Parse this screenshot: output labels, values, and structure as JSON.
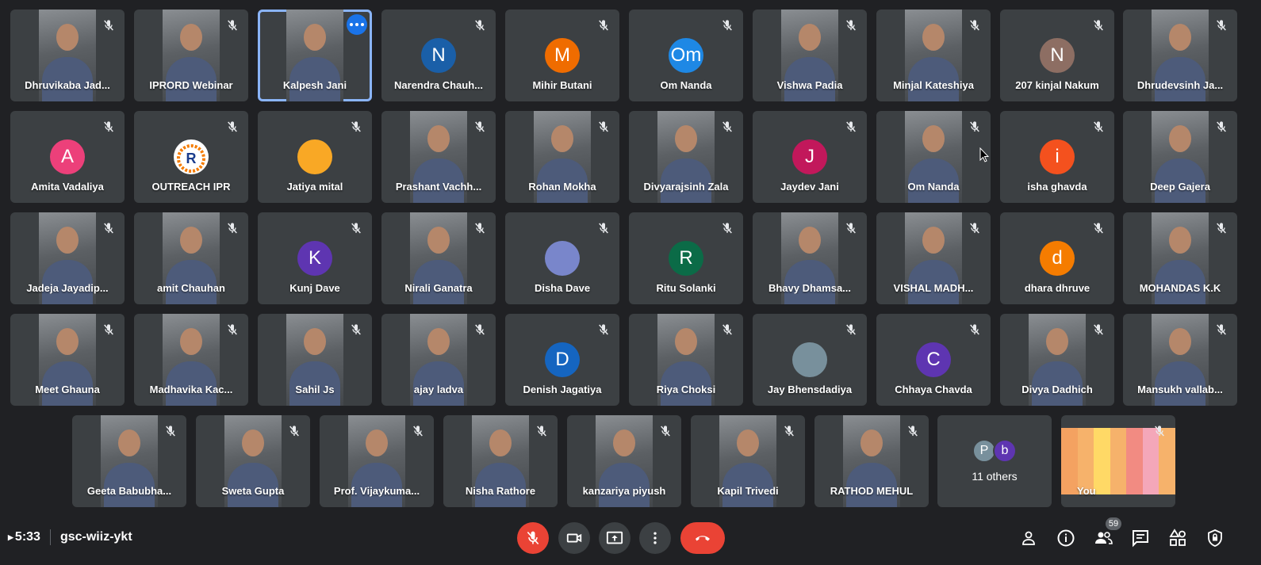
{
  "meeting": {
    "time": "5:33",
    "code": "gsc-wiiz-ykt",
    "participant_count": "59"
  },
  "colors": {
    "background": "#202124",
    "tile": "#3c4043",
    "accent_blue": "#1a73e8",
    "end_call_red": "#ea4335"
  },
  "participants": [
    {
      "name": "Dhruvikaba Jad...",
      "type": "video",
      "row": 0,
      "col": 0
    },
    {
      "name": "IPRORD Webinar",
      "type": "video",
      "row": 0,
      "col": 1
    },
    {
      "name": "Kalpesh Jani",
      "type": "video",
      "row": 0,
      "col": 2,
      "active": true
    },
    {
      "name": "Narendra Chauh...",
      "type": "avatar",
      "initial": "N",
      "color": "#1a5fa8",
      "row": 0,
      "col": 3
    },
    {
      "name": "Mihir Butani",
      "type": "avatar",
      "initial": "M",
      "color": "#ef6c00",
      "row": 0,
      "col": 4
    },
    {
      "name": "Om Nanda",
      "type": "avatar",
      "initial": "Om",
      "color": "#1e88e5",
      "row": 0,
      "col": 5
    },
    {
      "name": "Vishwa Padia",
      "type": "video",
      "row": 0,
      "col": 6
    },
    {
      "name": "Minjal Kateshiya",
      "type": "video",
      "row": 0,
      "col": 7
    },
    {
      "name": "207 kinjal Nakum",
      "type": "avatar",
      "initial": "N",
      "color": "#8d6e63",
      "row": 0,
      "col": 8
    },
    {
      "name": "Dhrudevsinh Ja...",
      "type": "video",
      "row": 0,
      "col": 9
    },
    {
      "name": "Amita Vadaliya",
      "type": "avatar",
      "initial": "A",
      "color": "#ec407a",
      "row": 1,
      "col": 0
    },
    {
      "name": "OUTREACH IPR",
      "type": "logo",
      "row": 1,
      "col": 1
    },
    {
      "name": "Jatiya mital",
      "type": "avatar",
      "initial": "",
      "color": "#f9a825",
      "row": 1,
      "col": 2
    },
    {
      "name": "Prashant Vachh...",
      "type": "video",
      "row": 1,
      "col": 3
    },
    {
      "name": "Rohan Mokha",
      "type": "video",
      "row": 1,
      "col": 4
    },
    {
      "name": "Divyarajsinh Zala",
      "type": "video",
      "row": 1,
      "col": 5
    },
    {
      "name": "Jaydev Jani",
      "type": "avatar",
      "initial": "J",
      "color": "#c2185b",
      "row": 1,
      "col": 6
    },
    {
      "name": "Om Nanda",
      "type": "video",
      "row": 1,
      "col": 7
    },
    {
      "name": "isha ghavda",
      "type": "avatar",
      "initial": "i",
      "color": "#f4511e",
      "row": 1,
      "col": 8
    },
    {
      "name": "Deep Gajera",
      "type": "video",
      "row": 1,
      "col": 9
    },
    {
      "name": "Jadeja Jayadip...",
      "type": "video",
      "row": 2,
      "col": 0
    },
    {
      "name": "amit Chauhan",
      "type": "video",
      "row": 2,
      "col": 1
    },
    {
      "name": "Kunj Dave",
      "type": "avatar",
      "initial": "K",
      "color": "#5e35b1",
      "row": 2,
      "col": 2
    },
    {
      "name": "Nirali Ganatra",
      "type": "video",
      "row": 2,
      "col": 3
    },
    {
      "name": "Disha Dave",
      "type": "avatar",
      "initial": "",
      "color": "#7986cb",
      "row": 2,
      "col": 4
    },
    {
      "name": "Ritu Solanki",
      "type": "avatar",
      "initial": "R",
      "color": "#0b6b47",
      "row": 2,
      "col": 5
    },
    {
      "name": "Bhavy Dhamsa...",
      "type": "video",
      "row": 2,
      "col": 6
    },
    {
      "name": "VISHAL MADH...",
      "type": "video",
      "row": 2,
      "col": 7
    },
    {
      "name": "dhara dhruve",
      "type": "avatar",
      "initial": "d",
      "color": "#f57c00",
      "row": 2,
      "col": 8
    },
    {
      "name": "MOHANDAS K.K",
      "type": "video",
      "row": 2,
      "col": 9
    },
    {
      "name": "Meet Ghauna",
      "type": "video",
      "row": 3,
      "col": 0
    },
    {
      "name": "Madhavika Kac...",
      "type": "video",
      "row": 3,
      "col": 1
    },
    {
      "name": "Sahil Js",
      "type": "video",
      "row": 3,
      "col": 2
    },
    {
      "name": "ajay ladva",
      "type": "video",
      "row": 3,
      "col": 3
    },
    {
      "name": "Denish Jagatiya",
      "type": "avatar",
      "initial": "D",
      "color": "#1565c0",
      "row": 3,
      "col": 4
    },
    {
      "name": "Riya Choksi",
      "type": "video",
      "row": 3,
      "col": 5
    },
    {
      "name": "Jay Bhensdadiya",
      "type": "avatar",
      "initial": "",
      "color": "#78909c",
      "row": 3,
      "col": 6
    },
    {
      "name": "Chhaya Chavda",
      "type": "avatar",
      "initial": "C",
      "color": "#5e35b1",
      "row": 3,
      "col": 7
    },
    {
      "name": "Divya Dadhich",
      "type": "video",
      "row": 3,
      "col": 8
    },
    {
      "name": "Mansukh vallab...",
      "type": "video",
      "row": 3,
      "col": 9
    },
    {
      "name": "Geeta Babubha...",
      "type": "video",
      "row": 4,
      "col": 0
    },
    {
      "name": "Sweta Gupta",
      "type": "video",
      "row": 4,
      "col": 1
    },
    {
      "name": "Prof. Vijaykuma...",
      "type": "video",
      "row": 4,
      "col": 2
    },
    {
      "name": "Nisha Rathore",
      "type": "video",
      "row": 4,
      "col": 3
    },
    {
      "name": "kanzariya piyush",
      "type": "video",
      "row": 4,
      "col": 4
    },
    {
      "name": "Kapil Trivedi",
      "type": "video",
      "row": 4,
      "col": 5
    },
    {
      "name": "RATHOD MEHUL",
      "type": "video",
      "row": 4,
      "col": 6
    }
  ],
  "others_tile": {
    "label": "11 others",
    "avatars": [
      {
        "initial": "P",
        "color": "#78909c"
      },
      {
        "initial": "b",
        "color": "#5e35b1"
      }
    ]
  },
  "self_tile": {
    "label": "You",
    "stripes": [
      "#f4a261",
      "#f6b26b",
      "#ffd966",
      "#f6b26b",
      "#f28b82",
      "#f4a7b9",
      "#f6b26b"
    ]
  },
  "controls": {
    "mic": "mic-off-icon",
    "camera": "videocam-icon",
    "present": "present-screen-icon",
    "more": "more-vert-icon",
    "hangup": "call-end-icon"
  },
  "right_controls": [
    "host-controls-icon",
    "info-icon",
    "people-icon",
    "chat-icon",
    "activities-icon",
    "security-icon"
  ]
}
